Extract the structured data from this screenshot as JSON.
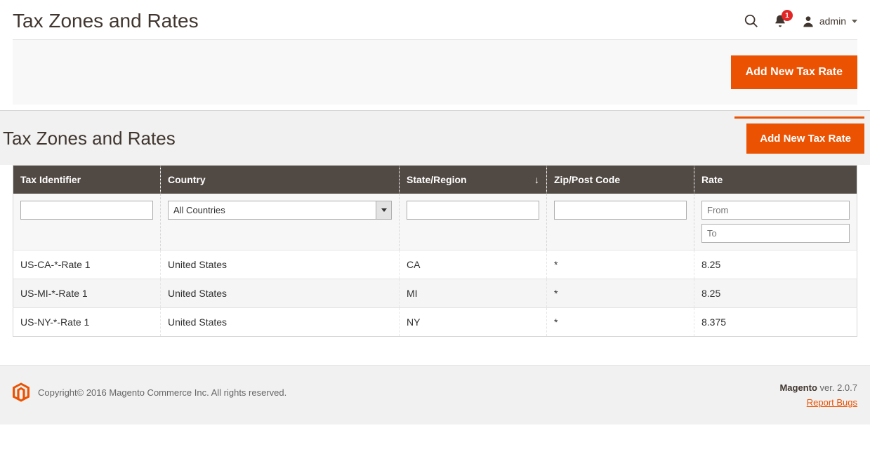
{
  "header": {
    "title": "Tax Zones and Rates",
    "notification_count": "1",
    "username": "admin",
    "add_button_label": "Add New Tax Rate"
  },
  "sub": {
    "title": "Tax Zones and Rates",
    "add_button_label": "Add New Tax Rate"
  },
  "grid": {
    "columns": {
      "tax_identifier": "Tax Identifier",
      "country": "Country",
      "state_region": "State/Region",
      "zip_post": "Zip/Post Code",
      "rate": "Rate"
    },
    "filters": {
      "tax_identifier": "",
      "country_selected": "All Countries",
      "state_region": "",
      "zip_post": "",
      "rate_from_placeholder": "From",
      "rate_to_placeholder": "To"
    },
    "rows": [
      {
        "tax_identifier": "US-CA-*-Rate 1",
        "country": "United States",
        "state_region": "CA",
        "zip_post": "*",
        "rate": "8.25"
      },
      {
        "tax_identifier": "US-MI-*-Rate 1",
        "country": "United States",
        "state_region": "MI",
        "zip_post": "*",
        "rate": "8.25"
      },
      {
        "tax_identifier": "US-NY-*-Rate 1",
        "country": "United States",
        "state_region": "NY",
        "zip_post": "*",
        "rate": "8.375"
      }
    ]
  },
  "footer": {
    "copyright": "Copyright© 2016 Magento Commerce Inc. All rights reserved.",
    "brand": "Magento",
    "version": " ver. 2.0.7",
    "report_bugs": "Report Bugs"
  }
}
